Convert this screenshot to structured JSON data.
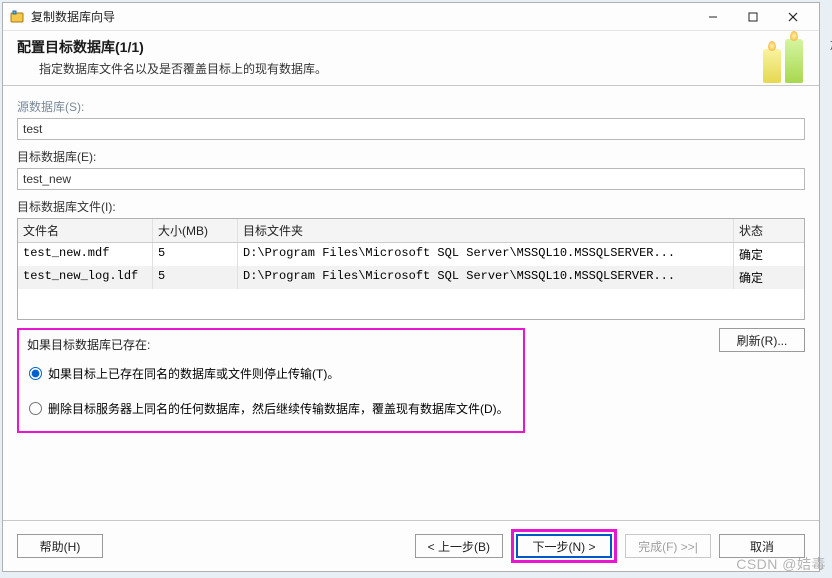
{
  "window": {
    "title": "复制数据库向导"
  },
  "header": {
    "title": "配置目标数据库(1/1)",
    "subtitle": "指定数据库文件名以及是否覆盖目标上的现有数据库。"
  },
  "fields": {
    "source_db_label": "源数据库(S):",
    "source_db_value": "test",
    "target_db_label": "目标数据库(E):",
    "target_db_value": "test_new",
    "target_files_label": "目标数据库文件(I):"
  },
  "grid": {
    "columns": {
      "name": "文件名",
      "size": "大小(MB)",
      "path": "目标文件夹",
      "status": "状态"
    },
    "rows": [
      {
        "name": "test_new.mdf",
        "size": "5",
        "path": "D:\\Program Files\\Microsoft SQL Server\\MSSQL10.MSSQLSERVER...",
        "status": "确定"
      },
      {
        "name": "test_new_log.ldf",
        "size": "5",
        "path": "D:\\Program Files\\Microsoft SQL Server\\MSSQL10.MSSQLSERVER...",
        "status": "确定"
      }
    ]
  },
  "refresh_button": "刷新(R)...",
  "radio_group": {
    "title": "如果目标数据库已存在:",
    "option_stop": "如果目标上已存在同名的数据库或文件则停止传输(T)。",
    "option_overwrite": "删除目标服务器上同名的任何数据库，然后继续传输数据库，覆盖现有数据库文件(D)。",
    "selected": "stop"
  },
  "footer": {
    "help": "帮助(H)",
    "back": "< 上一步(B)",
    "next": "下一步(N) >",
    "finish": "完成(F) >>|",
    "cancel": "取消"
  },
  "watermark": "CSDN @姞毒",
  "side_cut": "加"
}
